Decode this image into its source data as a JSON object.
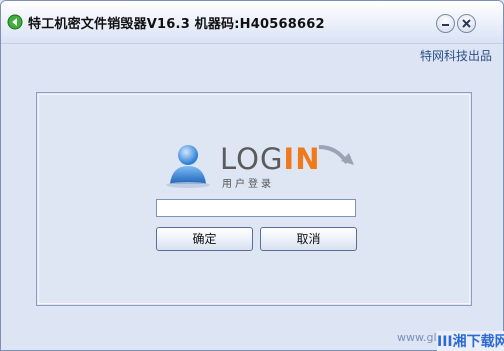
{
  "window": {
    "title": "特工机密文件销毁器V16.3 机器码:H40568662",
    "subtitle": "特网科技出品"
  },
  "login": {
    "title_main": "LOG",
    "title_accent": "IN",
    "subtitle": "用户登录",
    "password_value": "",
    "ok_label": "确定",
    "cancel_label": "取消"
  },
  "watermark": {
    "url": "www.glscc.net",
    "brand": "III湘下载网"
  },
  "colors": {
    "accent": "#ee7a1b",
    "frame": "#8d9dbb",
    "background": "#dde5f4"
  }
}
